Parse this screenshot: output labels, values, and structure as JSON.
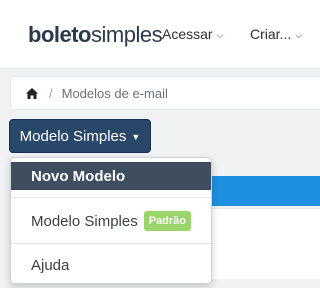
{
  "header": {
    "logo_bold": "boleto",
    "logo_rest": "simples",
    "nav": [
      {
        "label": "Acessar",
        "icon": "chevron-down-icon"
      },
      {
        "label": "Criar...",
        "icon": "chevron-down-icon"
      }
    ]
  },
  "breadcrumb": {
    "home_icon": "home-icon",
    "separator": "/",
    "current": "Modelos de e-mail"
  },
  "dropdown": {
    "button_label": "Modelo Simples",
    "button_icon": "caret-down-icon",
    "items": [
      {
        "label": "Novo Modelo",
        "active": true
      },
      {
        "label": "Modelo Simples",
        "badge": "Padrão"
      },
      {
        "label": "Ajuda"
      }
    ]
  },
  "colors": {
    "primary": "#294769",
    "active_item": "#3f4e5f",
    "badge": "#9ad46a",
    "accent_bar": "#1f8fe0"
  }
}
